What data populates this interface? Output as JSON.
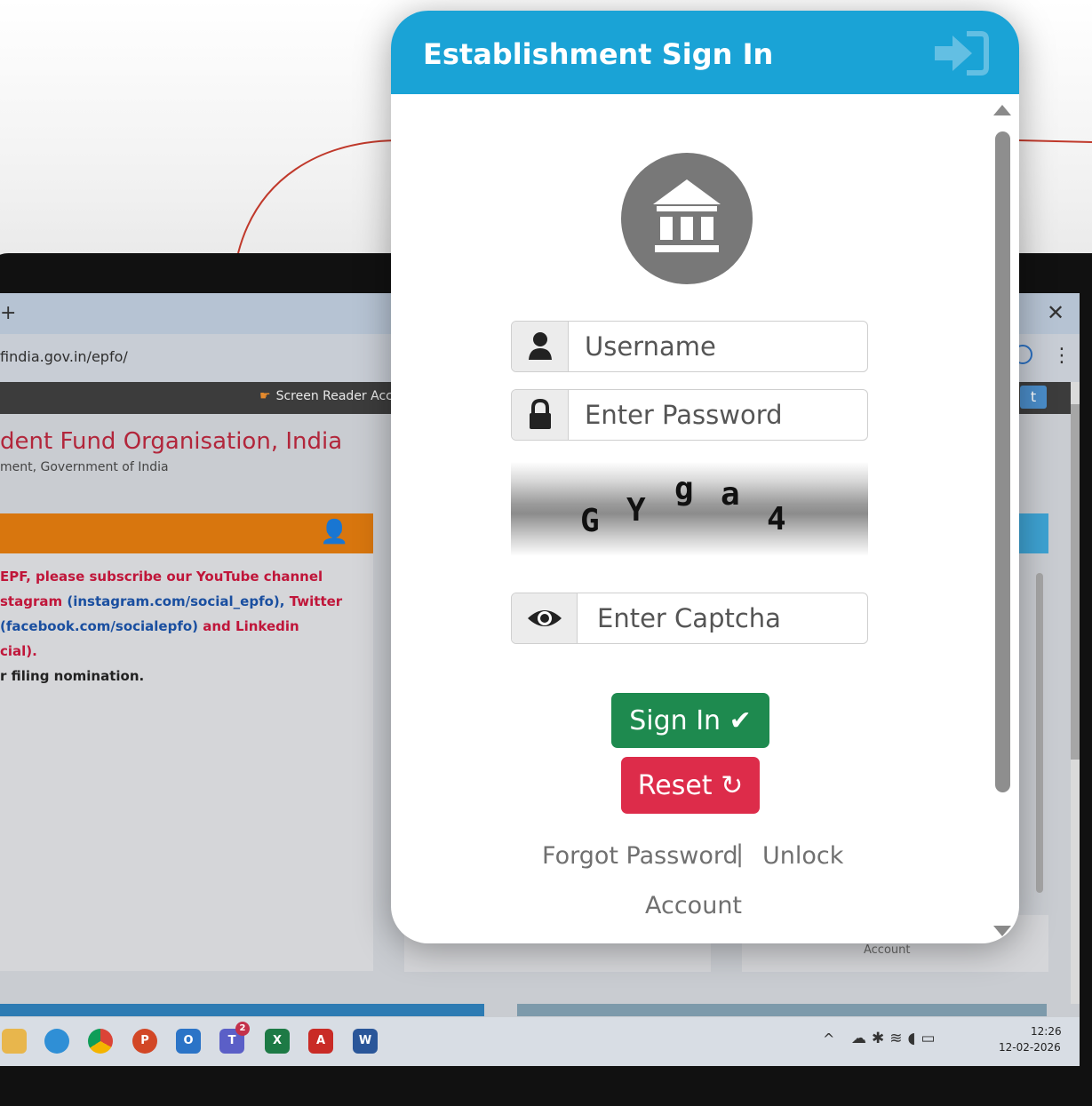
{
  "background": {
    "browser": {
      "tab_plus": "+",
      "close": "✕",
      "url": "findia.gov.in/epfo/",
      "menu": "⋮",
      "screen_reader": "Screen Reader Acc",
      "twitter": "t"
    },
    "site": {
      "title": "dent Fund Organisation, India",
      "subtitle": "ment, Government of India"
    },
    "announcement": [
      [
        {
          "t": "EPF, please subscribe our YouTube channel",
          "c": "red"
        }
      ],
      [
        {
          "t": "stagram ",
          "c": "red"
        },
        {
          "t": "(instagram.com/social_epfo),",
          "c": "blue"
        },
        {
          "t": "  Twitter",
          "c": "red"
        }
      ],
      [
        {
          "t": "  ",
          "c": "red"
        },
        {
          "t": "(facebook.com/socialepfo)",
          "c": "blue"
        },
        {
          "t": "   and   Linkedin",
          "c": "red"
        }
      ],
      [
        {
          "t": "cial).",
          "c": "red"
        }
      ],
      [
        {
          "t": "r filing nomination.",
          "c": "blk"
        }
      ]
    ],
    "right_panel_text": "Account",
    "taskbar": {
      "teams_badge": "2",
      "clock_time": "12:26",
      "clock_date": "12-02-2026"
    }
  },
  "modal": {
    "title": "Establishment Sign In",
    "username_placeholder": "Username",
    "password_placeholder": "Enter Password",
    "captcha_chars": [
      "G",
      "Y",
      "g",
      "a",
      "4"
    ],
    "captcha_placeholder": "Enter Captcha",
    "signin_label": "Sign In ✔",
    "reset_label": "Reset ↻",
    "forgot_password": "Forgot Password",
    "separator": "|",
    "unlock": "Unlock",
    "account": "Account"
  },
  "colors": {
    "header": "#1aa3d6",
    "signin": "#1e8a4f",
    "reset": "#dd2c4a",
    "icon_circle": "#787878"
  }
}
